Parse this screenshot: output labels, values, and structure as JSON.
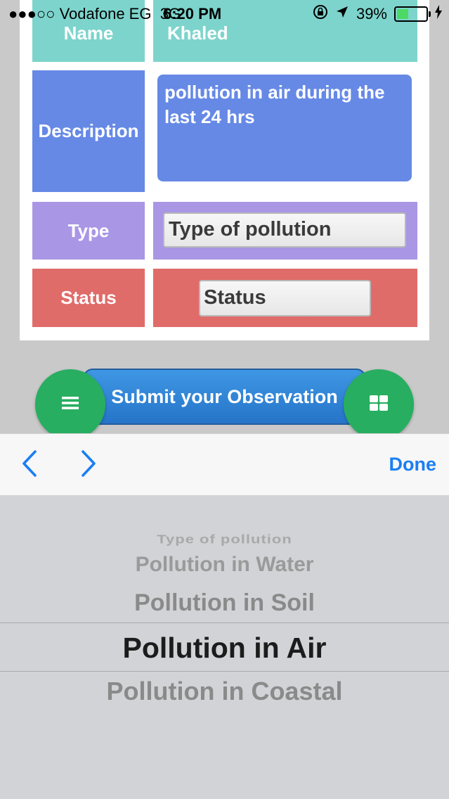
{
  "status_bar": {
    "signal": "●●●○○",
    "carrier": "Vodafone EG",
    "network": "3G",
    "time": "6:20 PM",
    "battery_percent": "39%",
    "battery_level": 0.39
  },
  "form": {
    "name": {
      "label": "Name",
      "value": "Khaled"
    },
    "description": {
      "label": "Description",
      "value": "pollution in air during the last 24 hrs"
    },
    "type": {
      "label": "Type",
      "placeholder": "Type of pollution"
    },
    "status": {
      "label": "Status",
      "placeholder": "Status"
    }
  },
  "submit_label": "Submit your Observation",
  "toolbar": {
    "done_label": "Done"
  },
  "picker": {
    "options": [
      "Type of pollution",
      "Pollution in Water",
      "Pollution in Soil",
      "Pollution in Air",
      "Pollution in Coastal"
    ],
    "selected": "Pollution in Air"
  },
  "colors": {
    "name_row": "#7dd4cc",
    "description_row": "#6689e6",
    "type_row": "#a996e5",
    "status_row": "#e06c6a",
    "fab": "#27ae60",
    "submit": "#2f86d8",
    "accent": "#1a7ef5"
  }
}
